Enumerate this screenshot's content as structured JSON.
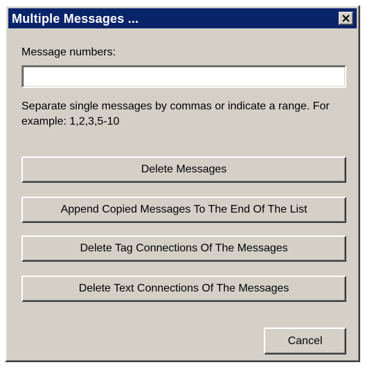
{
  "dialog": {
    "title": "Multiple Messages ...",
    "close_icon": "close-x-icon"
  },
  "form": {
    "message_numbers_label": "Message numbers:",
    "message_numbers_value": "",
    "help_text": "Separate single messages by commas or indicate a range. For example: 1,2,3,5-10"
  },
  "actions": {
    "delete_messages": "Delete Messages",
    "append_copied": "Append Copied Messages To The End Of The List",
    "delete_tag_connections": "Delete Tag Connections Of The Messages",
    "delete_text_connections": "Delete Text Connections Of The Messages",
    "cancel": "Cancel"
  },
  "colors": {
    "titlebar": "#0a246a",
    "face": "#d4d0c8"
  }
}
